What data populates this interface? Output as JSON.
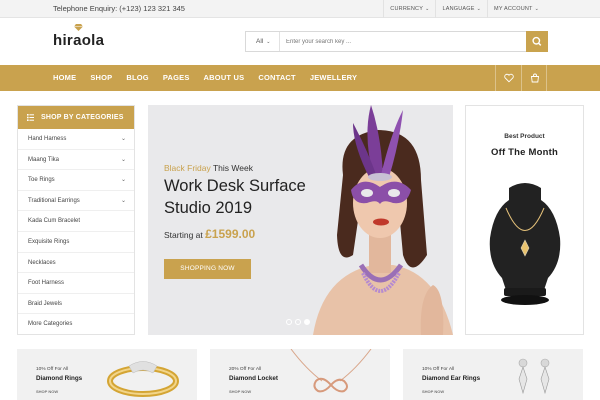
{
  "topbar": {
    "phone": "Telephone Enquiry: (+123) 123 321 345",
    "menus": [
      "CURRENCY",
      "LANGUAGE",
      "MY ACCOUNT"
    ]
  },
  "header": {
    "logo": "hiraola",
    "search": {
      "category": "All",
      "placeholder": "Enter your search key ..."
    }
  },
  "nav": {
    "items": [
      "HOME",
      "SHOP",
      "BLOG",
      "PAGES",
      "ABOUT US",
      "CONTACT",
      "JEWELLERY"
    ],
    "icons": [
      "heart-icon",
      "cart-icon"
    ]
  },
  "sidebar": {
    "title": "SHOP BY CATEGORIES",
    "items": [
      {
        "label": "Hand Harness",
        "expandable": true
      },
      {
        "label": "Maang Tika",
        "expandable": true
      },
      {
        "label": "Toe Rings",
        "expandable": true
      },
      {
        "label": "Traditional Earrings",
        "expandable": true
      },
      {
        "label": "Kada Cum Bracelet",
        "expandable": false
      },
      {
        "label": "Exquisite Rings",
        "expandable": false
      },
      {
        "label": "Necklaces",
        "expandable": false
      },
      {
        "label": "Foot Harness",
        "expandable": false
      },
      {
        "label": "Braid Jewels",
        "expandable": false
      },
      {
        "label": "More Categories",
        "expandable": false
      }
    ]
  },
  "hero": {
    "highlight": "Black Friday",
    "kicker": "This Week",
    "title": "Work Desk Surface Studio 2019",
    "price_prefix": "Starting at",
    "price": "£1599.00",
    "cta": "SHOPPING NOW",
    "slides": 3,
    "active_slide": 3
  },
  "promo": {
    "subtitle": "Best Product",
    "title": "Off The Month"
  },
  "banners": [
    {
      "offer": "10% Off For All",
      "title": "Diamond Rings",
      "link": "SHOP NOW"
    },
    {
      "offer": "20% Off For All",
      "title": "Diamond Locket",
      "link": "SHOP NOW"
    },
    {
      "offer": "10% Off For All",
      "title": "Diamond Ear Rings",
      "link": "SHOP NOW"
    }
  ],
  "colors": {
    "accent": "#c9a24e",
    "text": "#333333",
    "hero_bg": "#e9e9eb",
    "banner_bg": "#f1f1f1"
  }
}
